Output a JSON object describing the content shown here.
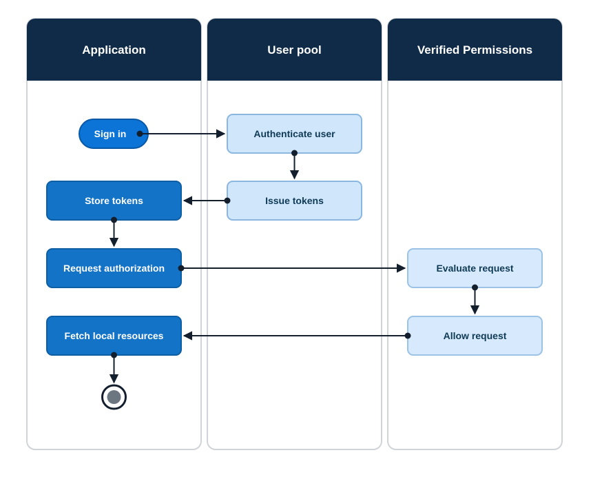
{
  "lanes": {
    "application": {
      "title": "Application"
    },
    "user_pool": {
      "title": "User pool"
    },
    "verified": {
      "title": "Verified Permissions"
    }
  },
  "nodes": {
    "sign_in": {
      "label": "Sign in"
    },
    "authenticate": {
      "label": "Authenticate user"
    },
    "issue_tokens": {
      "label": "Issue tokens"
    },
    "store_tokens": {
      "label": "Store tokens"
    },
    "request_auth": {
      "label": "Request authorization"
    },
    "evaluate": {
      "label": "Evaluate request"
    },
    "allow": {
      "label": "Allow request"
    },
    "fetch": {
      "label": "Fetch local resources"
    }
  }
}
